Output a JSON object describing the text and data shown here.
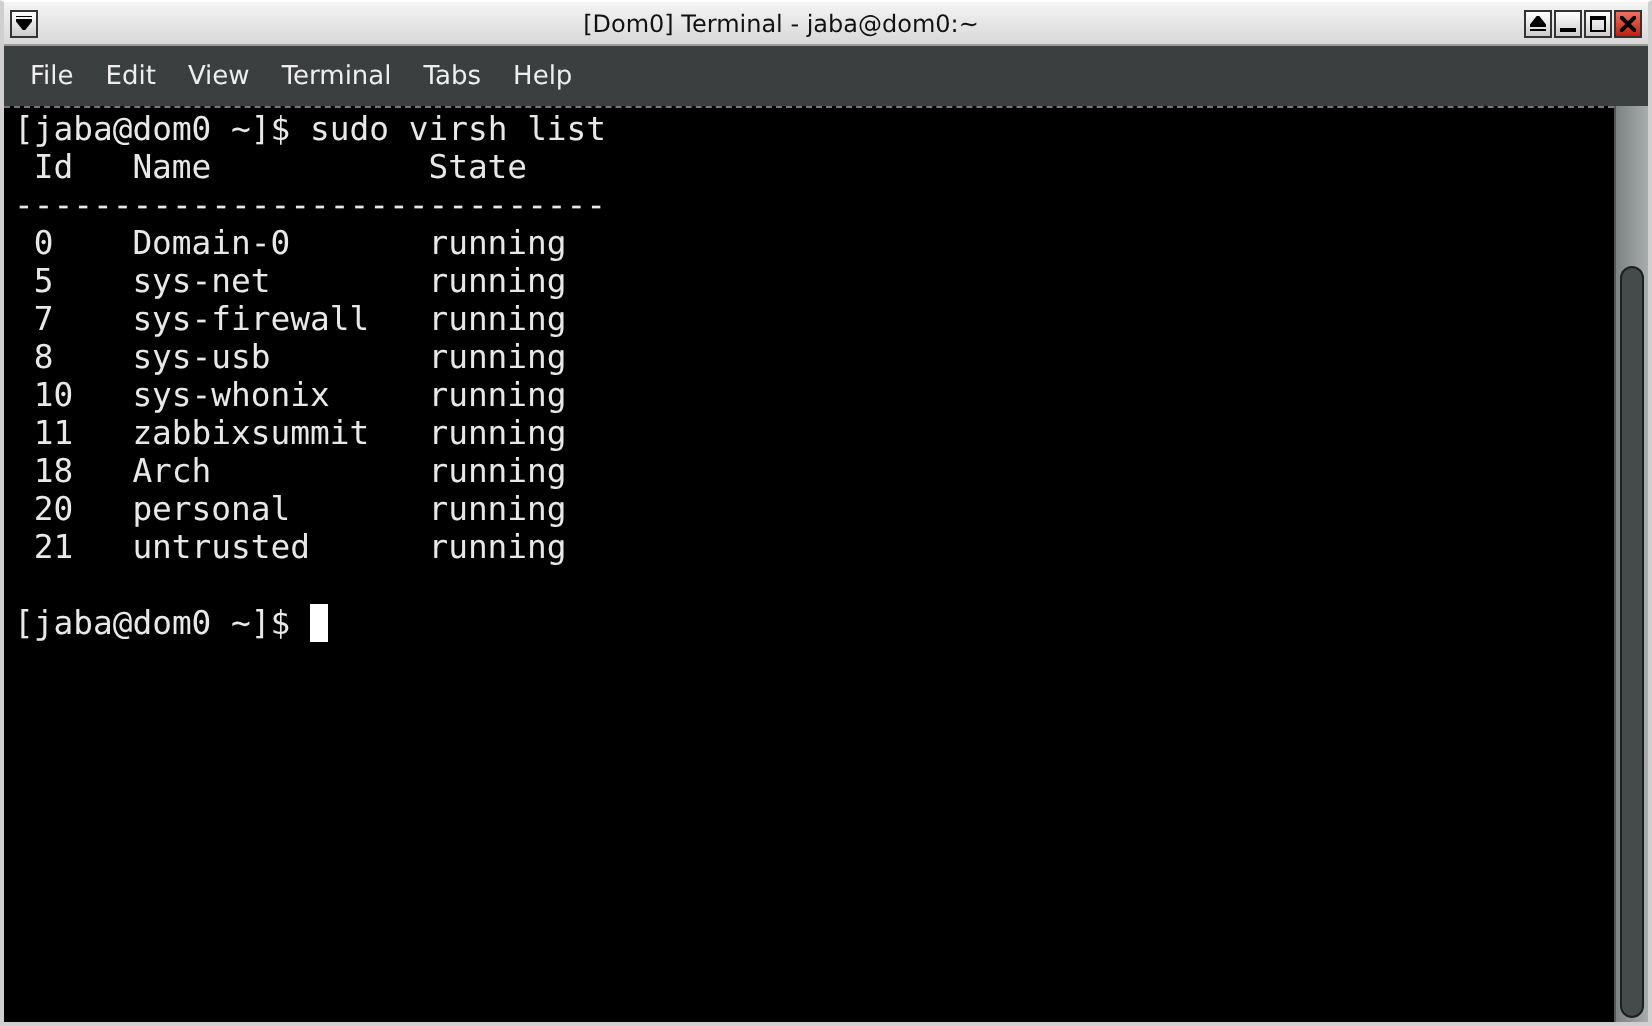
{
  "window": {
    "title": "[Dom0] Terminal - jaba@dom0:~"
  },
  "menu": [
    "File",
    "Edit",
    "View",
    "Terminal",
    "Tabs",
    "Help"
  ],
  "terminal": {
    "command_line": {
      "prompt": "[jaba@dom0 ~]$",
      "command": "sudo virsh list"
    },
    "columns": [
      "Id",
      "Name",
      "State"
    ],
    "separator": "------------------------------",
    "rows": [
      {
        "id": "0",
        "name": "Domain-0",
        "state": "running"
      },
      {
        "id": "5",
        "name": "sys-net",
        "state": "running"
      },
      {
        "id": "7",
        "name": "sys-firewall",
        "state": "running"
      },
      {
        "id": "8",
        "name": "sys-usb",
        "state": "running"
      },
      {
        "id": "10",
        "name": "sys-whonix",
        "state": "running"
      },
      {
        "id": "11",
        "name": "zabbixsummit",
        "state": "running"
      },
      {
        "id": "18",
        "name": "Arch",
        "state": "running"
      },
      {
        "id": "20",
        "name": "personal",
        "state": "running"
      },
      {
        "id": "21",
        "name": "untrusted",
        "state": "running"
      }
    ],
    "prompt": "[jaba@dom0 ~]$"
  }
}
